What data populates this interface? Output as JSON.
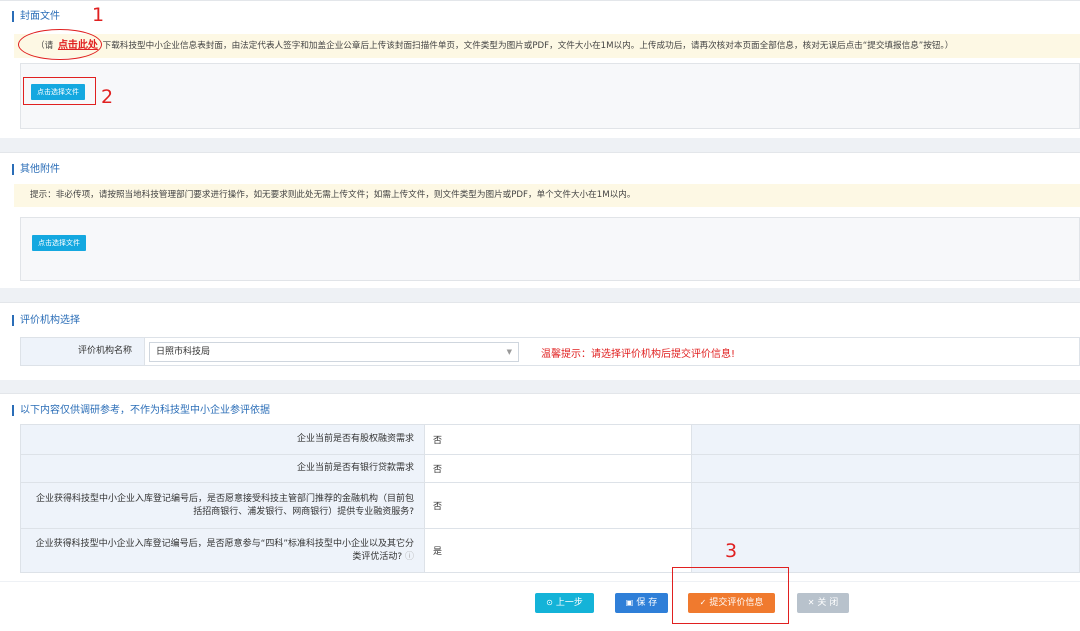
{
  "cover": {
    "title": "封面文件",
    "note_prefix": "（请",
    "download_link": "点击此处",
    "note_suffix": "下载科技型中小企业信息表封面，由法定代表人签字和加盖企业公章后上传该封面扫描件单页，文件类型为图片或PDF，文件大小在1M以内。上传成功后，请再次核对本页面全部信息，核对无误后点击“提交填报信息”按钮。）",
    "upload_label": "点击选择文件"
  },
  "attachments": {
    "title": "其他附件",
    "note": "提示：非必传项，请按照当地科技管理部门要求进行操作，如无要求则此处无需上传文件；如需上传文件，则文件类型为图片或PDF，单个文件大小在1M以内。",
    "upload_label": "点击选择文件"
  },
  "agency": {
    "title": "评价机构选择",
    "field_label": "评价机构名称",
    "selected_value": "日照市科技局",
    "warning": "温馨提示：请选择评价机构后提交评价信息!"
  },
  "survey": {
    "title": "以下内容仅供调研参考，不作为科技型中小企业参评依据",
    "rows": [
      {
        "question": "企业当前是否有股权融资需求",
        "answer": "否"
      },
      {
        "question": "企业当前是否有银行贷款需求",
        "answer": "否"
      },
      {
        "question": "企业获得科技型中小企业入库登记编号后，是否愿意接受科技主管部门推荐的金融机构（目前包括招商银行、浦发银行、网商银行）提供专业融资服务?",
        "answer": "否"
      },
      {
        "question": "企业获得科技型中小企业入库登记编号后，是否愿意参与“四科”标准科技型中小企业以及其它分类评优活动?",
        "answer": "是"
      }
    ]
  },
  "actions": {
    "prev_label": "上一步",
    "save_label": "保 存",
    "submit_label": "提交评价信息",
    "close_label": "关 闭"
  },
  "annotations": {
    "mark1": "1",
    "mark2": "2",
    "mark3": "3"
  },
  "colors": {
    "accent": "#2a6db7",
    "upload_button": "#14a8e0",
    "submit_button": "#f07a2e",
    "warning": "#e02020",
    "annotation": "#e02020"
  },
  "icons": {
    "prev": "circle-arrow-icon",
    "save": "floppy-icon",
    "submit": "check-circle-icon",
    "close": "close-icon",
    "select": "chevron-down-icon",
    "info": "info-circle-icon"
  }
}
